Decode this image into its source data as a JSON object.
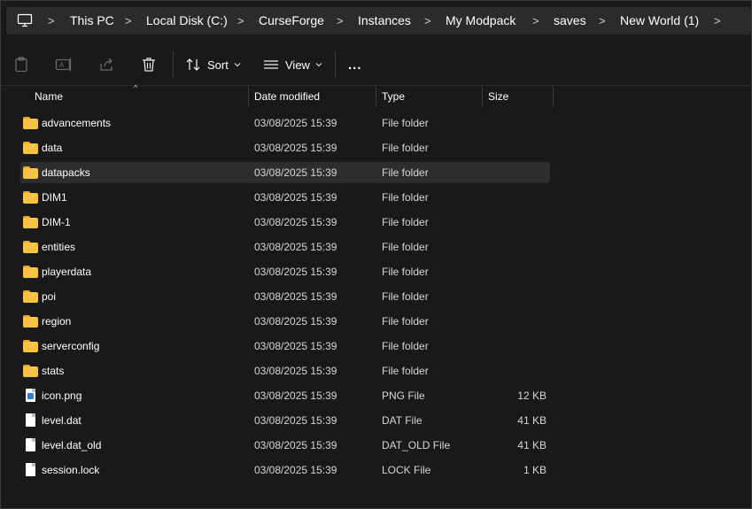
{
  "breadcrumb": {
    "icon": "computer-icon",
    "items": [
      "This PC",
      "Local Disk (C:)",
      "CurseForge",
      "Instances",
      "My Modpack",
      "saves",
      "New World (1)"
    ],
    "separator": ">"
  },
  "toolbar": {
    "icons": [
      "paste-icon",
      "rename-icon",
      "share-icon",
      "delete-icon"
    ],
    "sort_label": "Sort",
    "view_label": "View",
    "more_label": "..."
  },
  "columns": {
    "name": "Name",
    "date": "Date modified",
    "type": "Type",
    "size": "Size"
  },
  "files": [
    {
      "name": "advancements",
      "date": "03/08/2025 15:39",
      "type": "File folder",
      "size": "",
      "kind": "folder"
    },
    {
      "name": "data",
      "date": "03/08/2025 15:39",
      "type": "File folder",
      "size": "",
      "kind": "folder"
    },
    {
      "name": "datapacks",
      "date": "03/08/2025 15:39",
      "type": "File folder",
      "size": "",
      "kind": "folder",
      "selected": true
    },
    {
      "name": "DIM1",
      "date": "03/08/2025 15:39",
      "type": "File folder",
      "size": "",
      "kind": "folder"
    },
    {
      "name": "DIM-1",
      "date": "03/08/2025 15:39",
      "type": "File folder",
      "size": "",
      "kind": "folder"
    },
    {
      "name": "entities",
      "date": "03/08/2025 15:39",
      "type": "File folder",
      "size": "",
      "kind": "folder"
    },
    {
      "name": "playerdata",
      "date": "03/08/2025 15:39",
      "type": "File folder",
      "size": "",
      "kind": "folder"
    },
    {
      "name": "poi",
      "date": "03/08/2025 15:39",
      "type": "File folder",
      "size": "",
      "kind": "folder"
    },
    {
      "name": "region",
      "date": "03/08/2025 15:39",
      "type": "File folder",
      "size": "",
      "kind": "folder"
    },
    {
      "name": "serverconfig",
      "date": "03/08/2025 15:39",
      "type": "File folder",
      "size": "",
      "kind": "folder"
    },
    {
      "name": "stats",
      "date": "03/08/2025 15:39",
      "type": "File folder",
      "size": "",
      "kind": "folder"
    },
    {
      "name": "icon.png",
      "date": "03/08/2025 15:39",
      "type": "PNG File",
      "size": "12 KB",
      "kind": "image"
    },
    {
      "name": "level.dat",
      "date": "03/08/2025 15:39",
      "type": "DAT File",
      "size": "41 KB",
      "kind": "file"
    },
    {
      "name": "level.dat_old",
      "date": "03/08/2025 15:39",
      "type": "DAT_OLD File",
      "size": "41 KB",
      "kind": "file"
    },
    {
      "name": "session.lock",
      "date": "03/08/2025 15:39",
      "type": "LOCK File",
      "size": "1 KB",
      "kind": "file"
    }
  ],
  "colors": {
    "background": "#191919",
    "breadcrumb_bg": "#2b2b2b",
    "folder": "#f6c344",
    "selection": "#2d2d2d"
  }
}
